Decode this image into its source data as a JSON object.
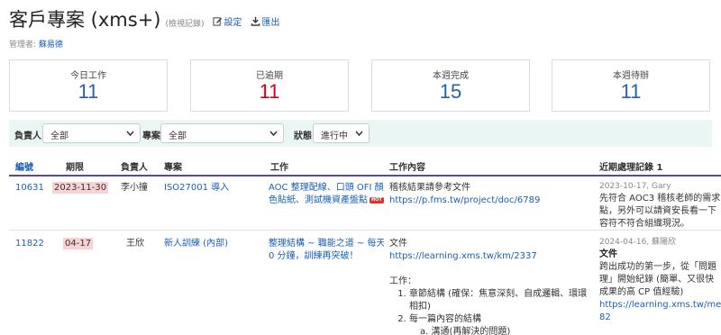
{
  "header": {
    "title": "客戶專案 (xms+)",
    "subtitle": "(檢視記錄)",
    "settings_label": "設定",
    "export_label": "匯出"
  },
  "manager": {
    "label": "管理者:",
    "name": "蘇易德"
  },
  "cards": [
    {
      "label": "今日工作",
      "value": "11",
      "color": "#2563a8"
    },
    {
      "label": "已逾期",
      "value": "11",
      "color": "#d0021b"
    },
    {
      "label": "本週完成",
      "value": "15",
      "color": "#2563a8"
    },
    {
      "label": "本週待辦",
      "value": "11",
      "color": "#2563a8"
    }
  ],
  "filters": {
    "owner_label": "負責人",
    "owner_value": "全部",
    "project_label": "專案",
    "project_value": "全部",
    "status_label": "狀態",
    "status_value": "進行中"
  },
  "table": {
    "headers": [
      "編號",
      "期限",
      "負責人",
      "專案",
      "工作",
      "工作內容",
      "近期處理記錄 1"
    ],
    "rows": [
      {
        "id": "10631",
        "deadline": "2023-11-30",
        "owner": "李小撞",
        "project": "ISO27001 導入",
        "task_line1": "AOC 整理配線、口頭 OFI 顏",
        "task_line2": "色貼紙、測試機資產盤點",
        "task_badge": "HOT",
        "content_line1": "稽核結果請參考文件",
        "content_link": "https://p.fms.tw/project/doc/6789",
        "recent_meta": "2023-10-17, Gary",
        "recent_line1": "先符合 AOC3 稽核老師的需求",
        "recent_line2": "點，另外可以請資安長看一下",
        "recent_line3": "容符不符合組織現況。"
      },
      {
        "id": "11822",
        "deadline": "04-17",
        "owner": "王欣",
        "project": "新人訓練 (內部)",
        "task_line1": "整理結構 ~ 職能之道 ~ 每天 1",
        "task_line2": "0 分鐘，訓練再突破！",
        "content_line1": "文件",
        "content_link": "https://learning.xms.tw/km/2337",
        "content_section": "工作：",
        "content_item1_line1": "章節結構 (確保：焦意深刻、自成邏輯、環環",
        "content_item1_line2": "相扣)",
        "content_item2": "每一篇內容的結構",
        "content_item3_partial": "a. 溝通(再解決的問題)",
        "recent_meta": "2024-04-16, 蘇陽欣",
        "recent_title": "文件",
        "recent_line1": "跨出成功的第一步，從「問題",
        "recent_line2": "理」開始紀錄 (簡單、又很快",
        "recent_line3": "成果的高 CP 值經驗)",
        "recent_link_line1": "https://learning.xms.tw/media",
        "recent_link_line2": "82"
      }
    ]
  }
}
